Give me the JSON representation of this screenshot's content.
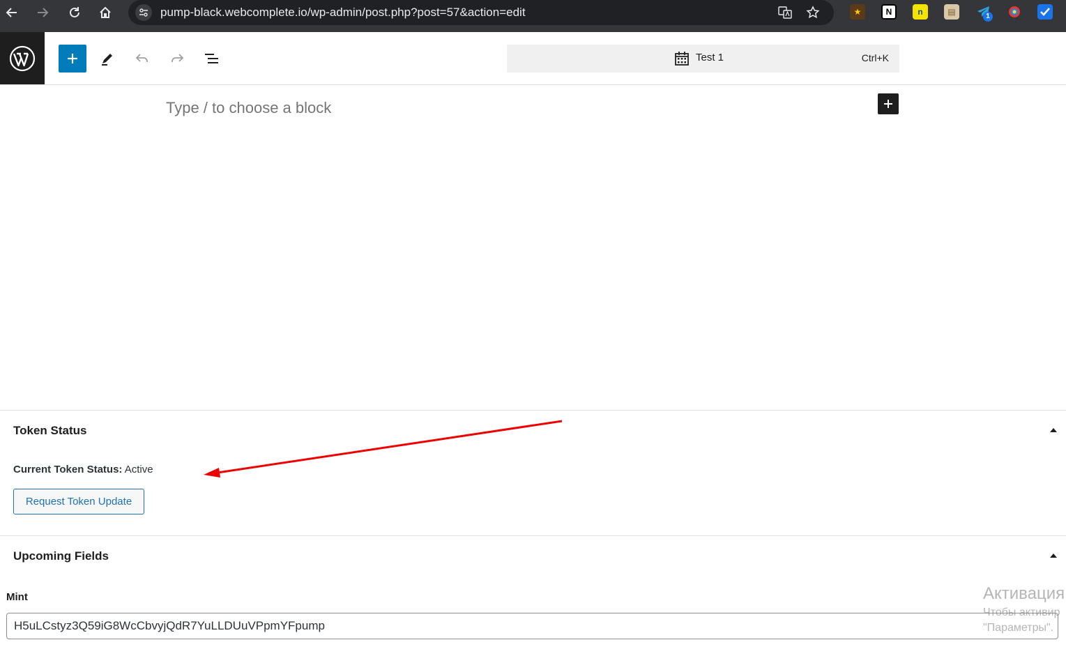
{
  "browser": {
    "url": "pump-black.webcomplete.io/wp-admin/post.php?post=57&action=edit",
    "extension_badge": "1"
  },
  "editor": {
    "document_title": "Test 1",
    "shortcut": "Ctrl+K",
    "block_placeholder": "Type / to choose a block"
  },
  "token_status_box": {
    "title": "Token Status",
    "status_label": "Current Token Status:",
    "status_value": "Active",
    "button_label": "Request Token Update"
  },
  "upcoming_fields_box": {
    "title": "Upcoming Fields",
    "mint_label": "Mint",
    "mint_value": "H5uLCstyz3Q59iG8WcCbvyjQdR7YuLLDUuVPpmYFpump"
  },
  "watermark": {
    "title": "Активация",
    "line1": "Чтобы активир",
    "line2": "\"Параметры\"."
  },
  "colors": {
    "wp_blue": "#007cba",
    "admin_blue": "#2271b1",
    "annotation_red": "#ee0000",
    "chrome_bg": "#35363a"
  }
}
